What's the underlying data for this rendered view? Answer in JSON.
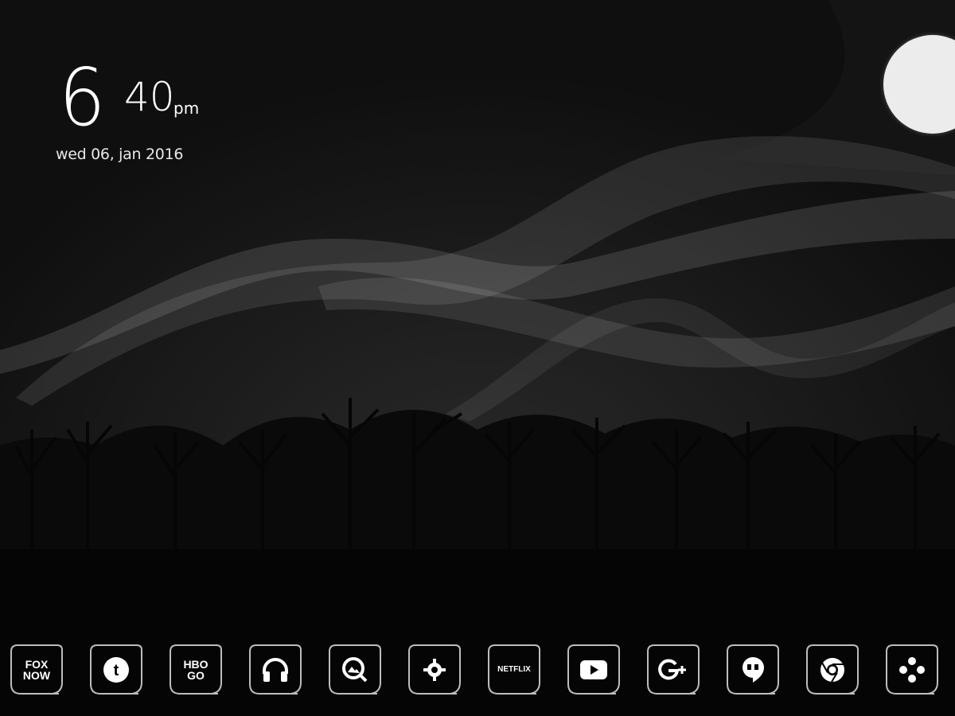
{
  "clock": {
    "hour": "6",
    "minute": "40",
    "ampm": "pm",
    "date": "wed 06, jan 2016"
  },
  "dock": {
    "apps": [
      {
        "name": "fox-now",
        "label_line1": "FOX",
        "label_line2": "NOW",
        "icon": "fox-now-icon"
      },
      {
        "name": "tumblr",
        "icon": "tumblr-icon"
      },
      {
        "name": "hbo-go",
        "label_line1": "HBO",
        "label_line2": "GO",
        "icon": "hbo-go-icon"
      },
      {
        "name": "music",
        "icon": "headphones-icon"
      },
      {
        "name": "gallery",
        "icon": "gallery-search-icon"
      },
      {
        "name": "settings",
        "icon": "gear-icon"
      },
      {
        "name": "netflix",
        "label": "NETFLIX",
        "icon": "netflix-icon"
      },
      {
        "name": "youtube",
        "icon": "youtube-icon"
      },
      {
        "name": "google-plus",
        "icon": "google-plus-icon"
      },
      {
        "name": "hangouts",
        "icon": "hangouts-icon"
      },
      {
        "name": "chrome",
        "icon": "chrome-icon"
      },
      {
        "name": "games",
        "icon": "gamepad-icon"
      }
    ]
  },
  "colors": {
    "background": "#0f0f0f",
    "ground": "#050505",
    "moon": "#ececec",
    "ribbon": "#ffffff",
    "foreground": "#ffffff"
  }
}
